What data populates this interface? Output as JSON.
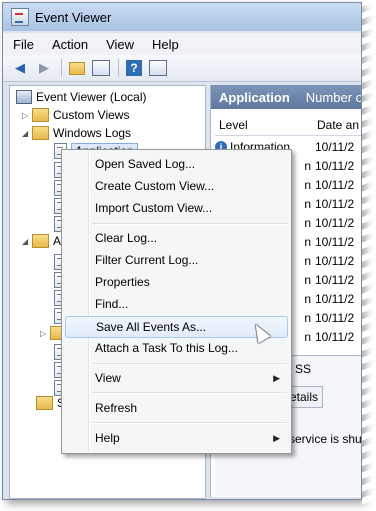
{
  "window": {
    "title": "Event Viewer"
  },
  "menubar": {
    "items": [
      "File",
      "Action",
      "View",
      "Help"
    ]
  },
  "toolbar": {
    "buttons": [
      "back-icon",
      "forward-icon",
      "up-folder-icon",
      "show-hide-tree-icon",
      "help-icon",
      "show-hide-action-pane-icon"
    ]
  },
  "tree": {
    "root": "Event Viewer (Local)",
    "custom_views": "Custom Views",
    "windows_logs": "Windows Logs",
    "application": "Application",
    "partial_a": "A",
    "partial_s": "S"
  },
  "right": {
    "header_bold": "Application",
    "header_rest": "Number of e",
    "col_level": "Level",
    "col_date": "Date an",
    "rows": [
      {
        "level": "Information",
        "date": "10/11/2"
      },
      {
        "level": "n",
        "date": "10/11/2"
      },
      {
        "level": "n",
        "date": "10/11/2"
      },
      {
        "level": "n",
        "date": "10/11/2"
      },
      {
        "level": "n",
        "date": "10/11/2"
      },
      {
        "level": "n",
        "date": "10/11/2"
      },
      {
        "level": "n",
        "date": "10/11/2"
      },
      {
        "level": "n",
        "date": "10/11/2"
      },
      {
        "level": "n",
        "date": "10/11/2"
      },
      {
        "level": "n",
        "date": "10/11/2"
      },
      {
        "level": "n",
        "date": "10/11/2"
      }
    ],
    "detail_tab_ss": "SS",
    "detail_tab_details": "etails",
    "detail_snippet": "service is shutt"
  },
  "context_menu": {
    "items": [
      "Open Saved Log...",
      "Create Custom View...",
      "Import Custom View...",
      "Clear Log...",
      "Filter Current Log...",
      "Properties",
      "Find...",
      "Save All Events As...",
      "Attach a Task To this Log...",
      "View",
      "Refresh",
      "Help"
    ]
  }
}
